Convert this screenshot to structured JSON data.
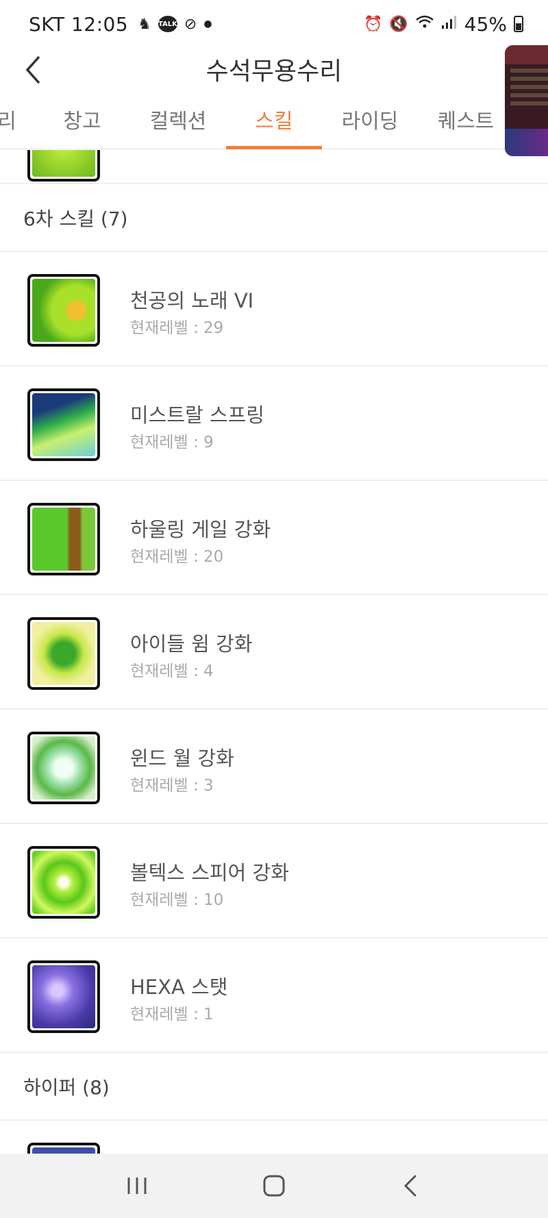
{
  "status_bar": {
    "carrier_time": "SKT 12:05",
    "talk_badge": "TALK",
    "battery": "45%"
  },
  "header": {
    "title": "수석무용수리"
  },
  "tabs": [
    {
      "label": "리",
      "active": false
    },
    {
      "label": "창고",
      "active": false
    },
    {
      "label": "컬렉션",
      "active": false
    },
    {
      "label": "스킬",
      "active": true
    },
    {
      "label": "라이딩",
      "active": false
    },
    {
      "label": "퀘스트",
      "active": false
    }
  ],
  "sections": {
    "sixth": {
      "title": "6차 스킬 (7)"
    },
    "hyper": {
      "title": "하이퍼 (8)"
    }
  },
  "skills": [
    {
      "name": "천공의 노래 VI",
      "level": "현재레벨 : 29",
      "color": "#8fd12a"
    },
    {
      "name": "미스트랄 스프링",
      "level": "현재레벨 : 9",
      "color": "#2e9e4a"
    },
    {
      "name": "하울링 게일 강화",
      "level": "현재레벨 : 20",
      "color": "#7cc83a"
    },
    {
      "name": "아이들 윔 강화",
      "level": "현재레벨 : 4",
      "color": "#bfe24a"
    },
    {
      "name": "윈드 월 강화",
      "level": "현재레벨 : 3",
      "color": "#a6dc9a"
    },
    {
      "name": "볼텍스 스피어 강화",
      "level": "현재레벨 : 10",
      "color": "#7ad61e"
    },
    {
      "name": "HEXA 스탯",
      "level": "현재레벨 : 1",
      "color": "#6a56c8"
    }
  ],
  "colors": {
    "accent": "#f0803a",
    "divider": "#eeeeee"
  }
}
